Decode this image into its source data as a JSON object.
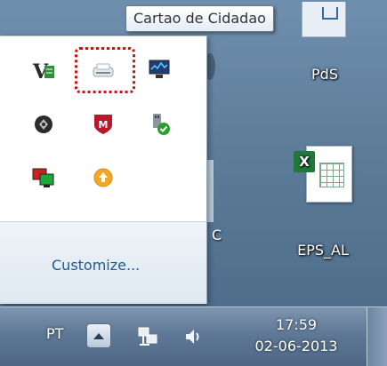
{
  "tooltip": {
    "text": "Cartao de Cidadao"
  },
  "desktop": {
    "icons": [
      {
        "label": "PdS"
      },
      {
        "label": "EPS_AL"
      }
    ],
    "partial_label": "C"
  },
  "tray_popup": {
    "icons": [
      {
        "name": "vm-icon"
      },
      {
        "name": "card-reader-icon",
        "tooltip": "Cartao de Cidadao",
        "highlighted": true
      },
      {
        "name": "monitor-icon"
      },
      {
        "name": "ball-icon"
      },
      {
        "name": "mcafee-icon"
      },
      {
        "name": "safely-remove-icon"
      },
      {
        "name": "network-monitors-icon"
      },
      {
        "name": "update-icon"
      }
    ],
    "customize_label": "Customize..."
  },
  "taskbar": {
    "language": "PT",
    "time": "17:59",
    "date": "02-06-2013"
  },
  "colors": {
    "highlight_border": "#cc1111",
    "link": "#1c5a9a",
    "taskbar": "#5f7896"
  }
}
